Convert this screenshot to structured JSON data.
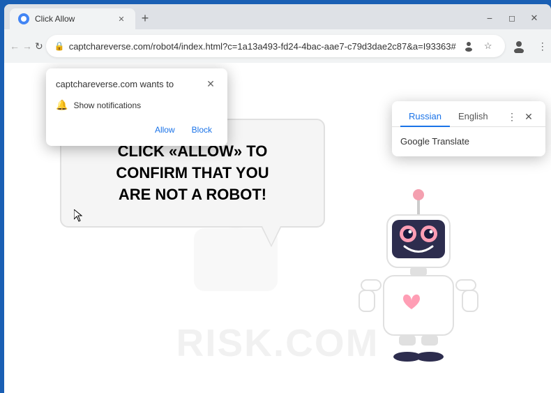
{
  "browser": {
    "tab_title": "Click Allow",
    "new_tab_label": "+",
    "url": "captchareverse.com/robot4/index.html?c=1a13a493-fd24-4bac-aae7-c79d3dae2c87&a=I93363#",
    "nav_back": "←",
    "nav_forward": "→",
    "nav_reload": "↻"
  },
  "notification": {
    "title": "captchareverse.com wants to",
    "description": "Show notifications",
    "allow_label": "Allow",
    "block_label": "Block"
  },
  "translate": {
    "tab_russian": "Russian",
    "tab_english": "English",
    "service": "Google Translate"
  },
  "page": {
    "bubble_line1": "CLICK «ALLOW» TO CONFIRM THAT YOU",
    "bubble_line2": "ARE NOT A ROBOT!"
  },
  "watermark": {
    "text": "risk.com"
  },
  "colors": {
    "accent": "#1a73e8",
    "allow_color": "#1a73e8",
    "block_color": "#1a73e8",
    "tab_active_color": "#1a73e8"
  }
}
